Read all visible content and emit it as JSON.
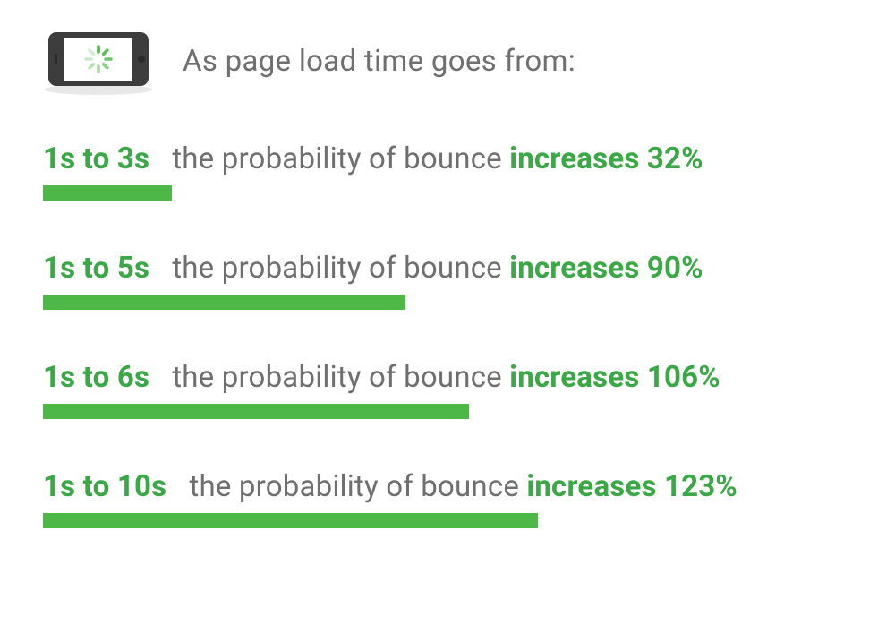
{
  "title": "As page load time goes from:",
  "middle_text": "the probability of bounce",
  "increase_word": "increases",
  "colors": {
    "accent": "#39a845",
    "bar": "#4db748",
    "text": "#6f6f6f"
  },
  "rows": [
    {
      "range": "1s to 3s",
      "percent": "32%",
      "bar_width_pct": 15.9
    },
    {
      "range": "1s to 5s",
      "percent": "90%",
      "bar_width_pct": 44.8
    },
    {
      "range": "1s to 6s",
      "percent": "106%",
      "bar_width_pct": 52.7
    },
    {
      "range": "1s to 10s",
      "percent": "123%",
      "bar_width_pct": 61.2
    }
  ],
  "chart_data": {
    "type": "bar",
    "title": "As page load time goes from:",
    "categories": [
      "1s to 3s",
      "1s to 5s",
      "1s to 6s",
      "1s to 10s"
    ],
    "values": [
      32,
      90,
      106,
      123
    ],
    "series_label": "Probability of bounce increase (%)",
    "xlabel": "",
    "ylabel": "",
    "ylim": [
      0,
      123
    ]
  }
}
